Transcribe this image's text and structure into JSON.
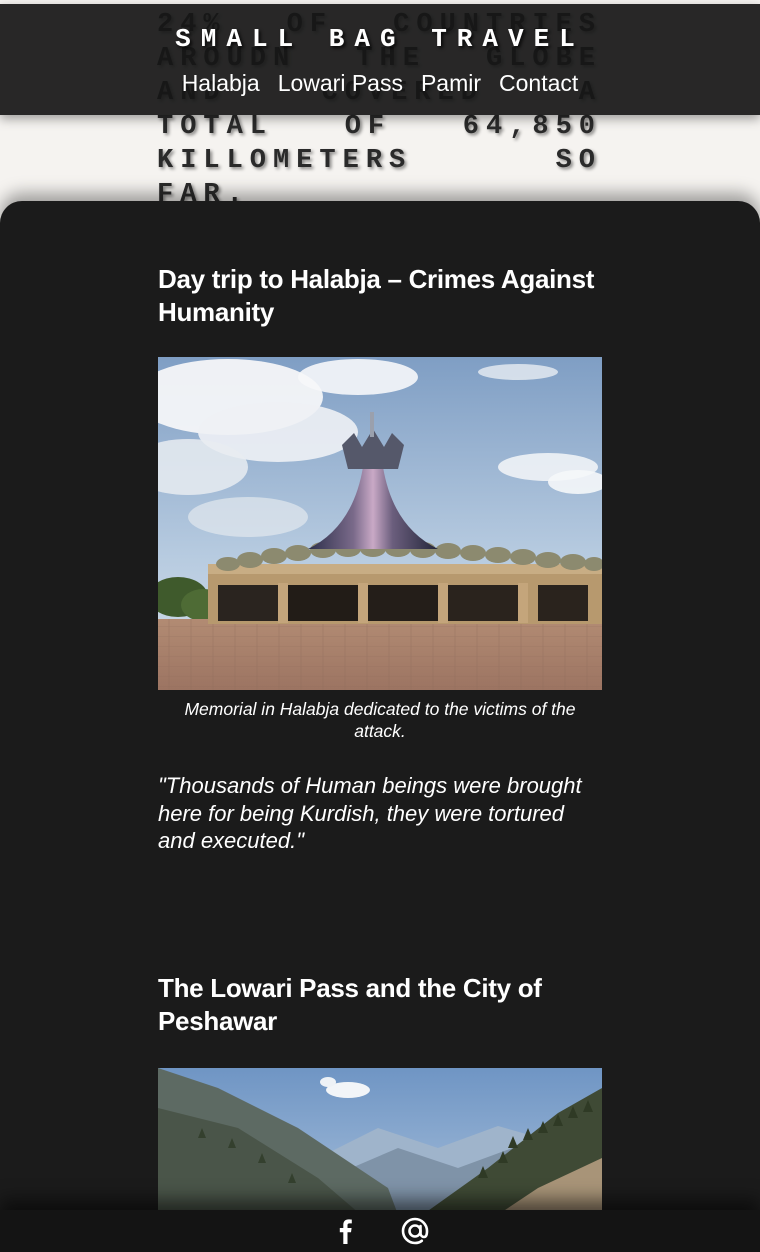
{
  "hero": {
    "text": "24% of countries aroudn the globe and covered a total of 64,850 killometers so far."
  },
  "header": {
    "brand": "SMALL BAG TRAVEL",
    "nav": [
      {
        "label": "Halabja"
      },
      {
        "label": "Lowari Pass"
      },
      {
        "label": "Pamir"
      },
      {
        "label": "Contact"
      }
    ]
  },
  "articles": [
    {
      "title": "Day trip to Halabja – Crimes Against Humanity",
      "caption": "Memorial in Halabja dedicated to the victims of the attack.",
      "quote": "\"Thousands of Human beings were brought here for being Kurdish, they were tortured and executed.\""
    },
    {
      "title": "The Lowari Pass and the City of Peshawar"
    }
  ],
  "footer": {
    "icons": [
      "facebook-icon",
      "at-sign-icon"
    ]
  }
}
